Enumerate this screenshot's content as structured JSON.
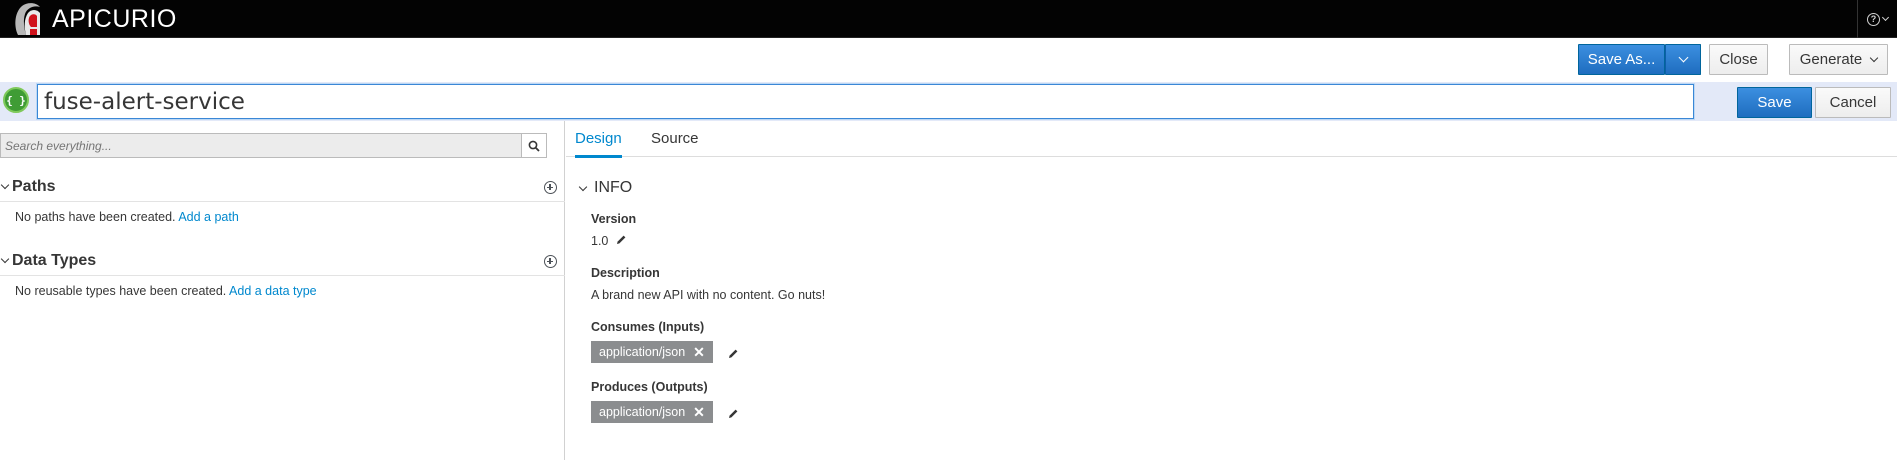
{
  "navbar": {
    "brand": "APICURIO",
    "help_icon": "help-icon",
    "help_caret": "chevron-down-icon"
  },
  "toolbar": {
    "save_as_label": "Save As...",
    "close_label": "Close",
    "generate_label": "Generate"
  },
  "title": {
    "value": "fuse-alert-service",
    "icon": "{ }",
    "save_label": "Save",
    "cancel_label": "Cancel"
  },
  "left": {
    "search_placeholder": "Search everything...",
    "paths": {
      "title": "Paths",
      "empty_text": "No paths have been created.",
      "link": "Add a path"
    },
    "data_types": {
      "title": "Data Types",
      "empty_text": "No reusable types have been created.",
      "link": "Add a data type"
    }
  },
  "right": {
    "tabs": [
      {
        "label": "Design",
        "active": true
      },
      {
        "label": "Source",
        "active": false
      }
    ],
    "info": {
      "title": "INFO",
      "version_label": "Version",
      "version_value": "1.0",
      "description_label": "Description",
      "description_value": "A brand new API with no content. Go nuts!",
      "consumes_label": "Consumes (Inputs)",
      "consumes_tag": "application/json",
      "produces_label": "Produces (Outputs)",
      "produces_tag": "application/json"
    }
  },
  "colors": {
    "navbar_bg": "#030303",
    "primary": "#0088ce",
    "title_row_bg": "#e3e9f8",
    "api_icon": "#3f9c35",
    "tag_bg": "#8b8d8f"
  }
}
